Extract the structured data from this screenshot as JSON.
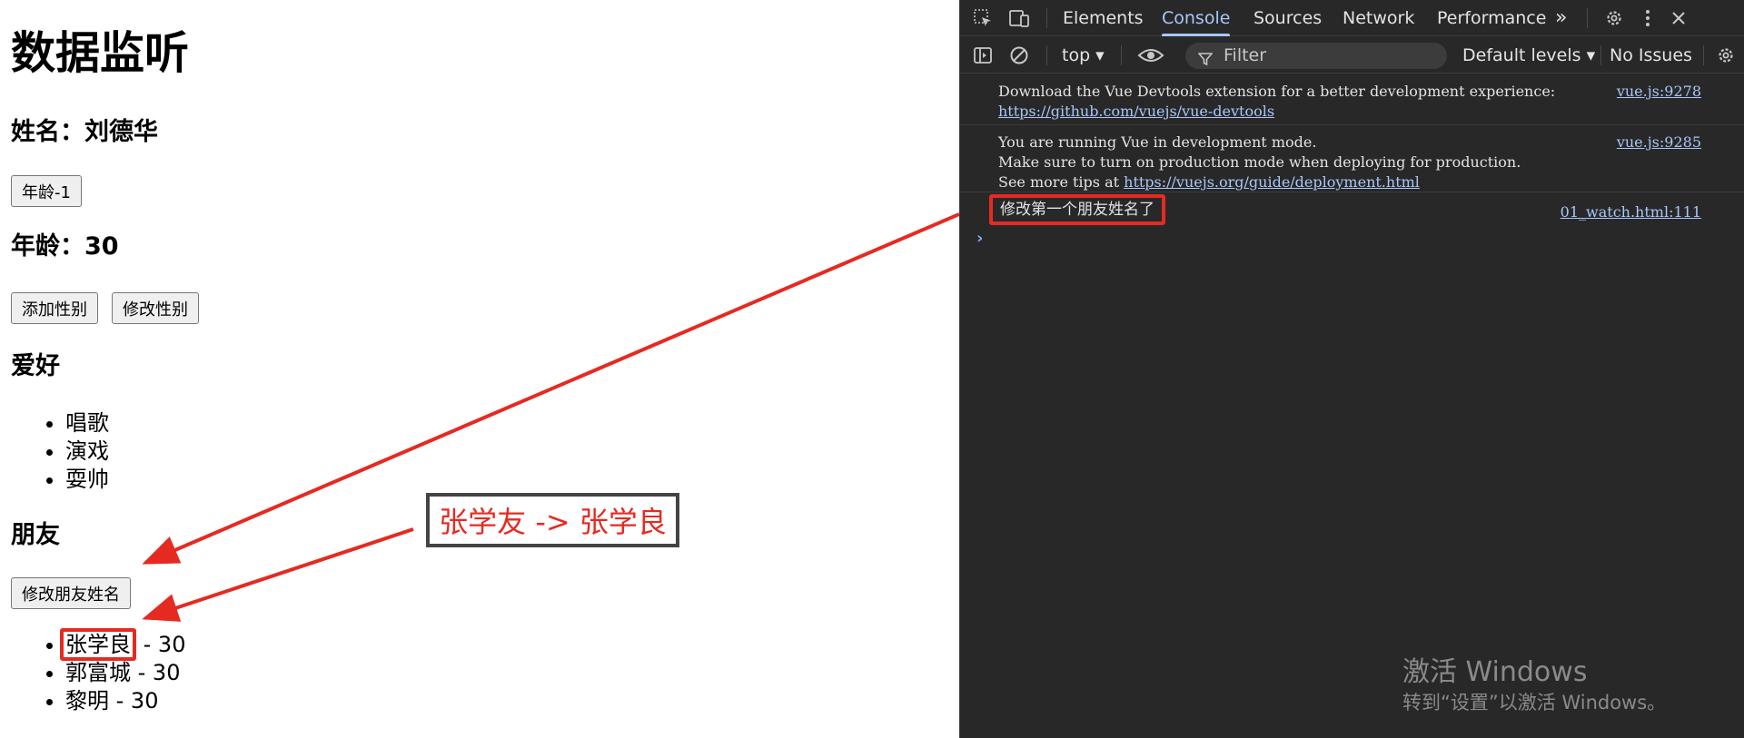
{
  "page": {
    "title": "数据监听",
    "name_line": "姓名：刘德华",
    "age_minus_button": "年龄-1",
    "age_line": "年龄：30",
    "add_gender_button": "添加性别",
    "modify_gender_button": "修改性别",
    "hobbies_heading": "爱好",
    "hobbies": [
      "唱歌",
      "演戏",
      "耍帅"
    ],
    "friends_heading": "朋友",
    "modify_friend_button": "修改朋友姓名",
    "friends": [
      {
        "name": "张学良",
        "suffix": " - 30"
      },
      {
        "name": "郭富城",
        "suffix": " - 30"
      },
      {
        "name": "黎明",
        "suffix": " - 30"
      }
    ],
    "annotation_note": "张学友 -> 张学良"
  },
  "devtools": {
    "tabs": [
      "Elements",
      "Console",
      "Sources",
      "Network",
      "Performance"
    ],
    "active_tab": "Console",
    "more_tabs_glyph": "»",
    "context": "top",
    "filter_placeholder": "Filter",
    "levels": "Default levels",
    "issues": "No Issues",
    "icons": {
      "inspect": "inspect-element-icon",
      "device": "device-toolbar-icon",
      "settings": "gear-icon",
      "menu": "kebab-menu-icon",
      "close": "close-icon",
      "sidebar": "sidebar-toggle-icon",
      "clear": "clear-console-icon",
      "eye": "live-expression-icon",
      "filter": "filter-icon"
    },
    "messages": [
      {
        "lines": [
          "Download the Vue Devtools extension for a better development experience:"
        ],
        "link": "https://github.com/vuejs/vue-devtools",
        "source": "vue.js:9278"
      },
      {
        "lines": [
          "You are running Vue in development mode.",
          "Make sure to turn on production mode when deploying for production."
        ],
        "prefix": "See more tips at ",
        "link": "https://vuejs.org/guide/deployment.html",
        "source": "vue.js:9285"
      },
      {
        "text": "修改第一个朋友姓名了",
        "source": "01_watch.html:111"
      }
    ],
    "prompt": "›"
  },
  "watermark": {
    "line1": "激活 Windows",
    "line2": "转到“设置”以激活 Windows。"
  },
  "colors": {
    "annotation_red": "#e52a22",
    "devtools_bg": "#282828",
    "link_blue": "#a8c7fa"
  }
}
